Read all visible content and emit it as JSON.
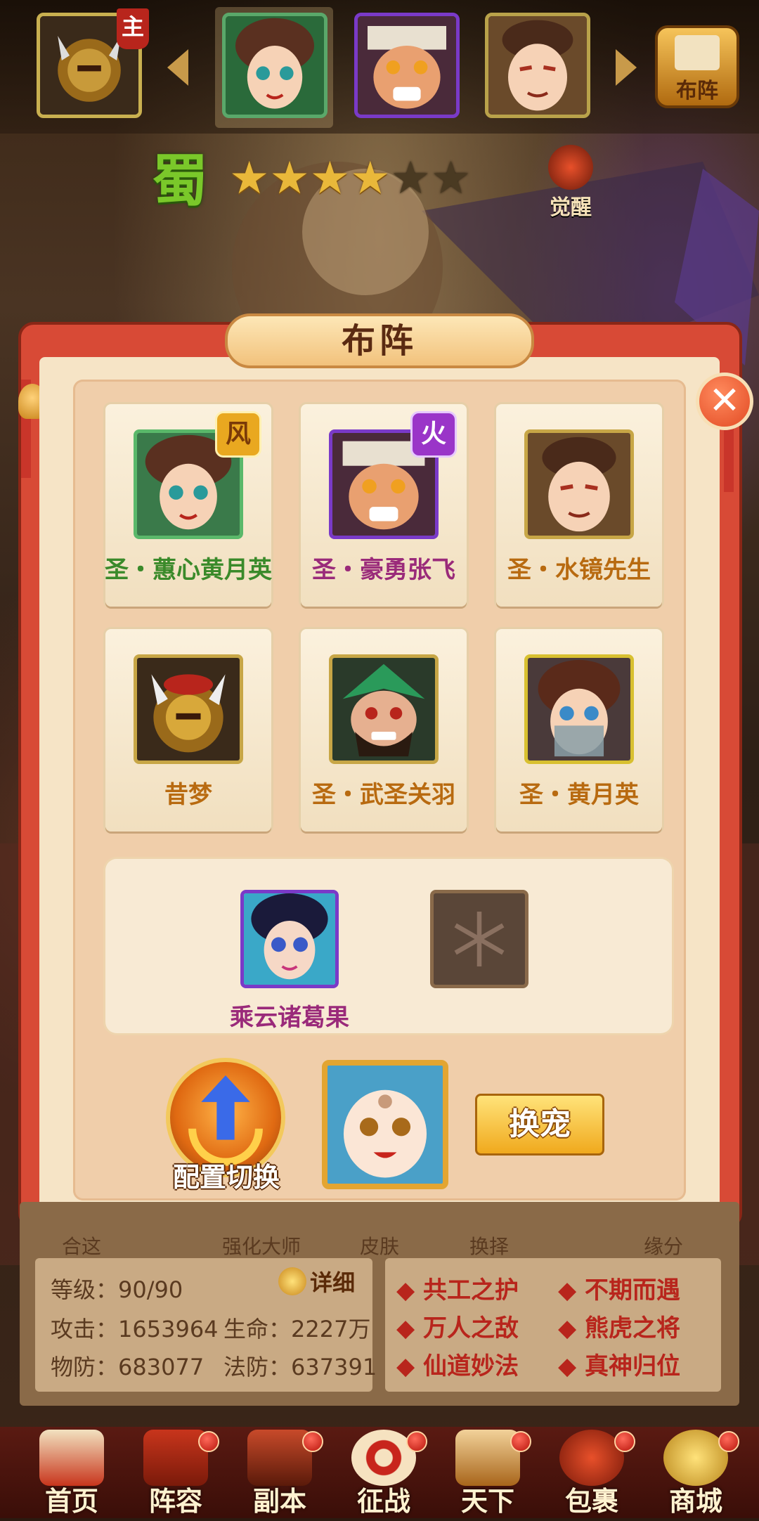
{
  "top_bar": {
    "lord_badge": "主",
    "formation_label": "布阵",
    "heroes": [
      "lord-hero",
      "huang-yueying",
      "zhang-fei",
      "shui-jing"
    ]
  },
  "hero_info": {
    "faction": "蜀",
    "stars": 6,
    "stars_lit": 4,
    "awaken_label": "觉醒"
  },
  "dialog": {
    "title": "布阵",
    "cards": [
      {
        "name": "圣・蕙心黄月英",
        "color": "#3a8a2a",
        "badge": "风",
        "badge_color": "#e9a820"
      },
      {
        "name": "圣・豪勇张飞",
        "color": "#9a2a7a",
        "badge": "火",
        "badge_color": "#9a35c8"
      },
      {
        "name": "圣・水镜先生",
        "color": "#b86a10",
        "badge": "",
        "badge_color": ""
      },
      {
        "name": "昔梦",
        "color": "#b86a10",
        "badge": "",
        "badge_color": ""
      },
      {
        "name": "圣・武圣关羽",
        "color": "#b86a10",
        "badge": "",
        "badge_color": ""
      },
      {
        "name": "圣・黄月英",
        "color": "#b86a10",
        "badge": "",
        "badge_color": ""
      }
    ],
    "support_name": "乘云诸葛果",
    "support_color": "#9a2a7a",
    "config_switch_label": "配置切换",
    "swap_pet_label": "换宠"
  },
  "tabs_partial": [
    "合这",
    "强化大师",
    "皮肤",
    "换择",
    "缘分"
  ],
  "stats": {
    "level_label": "等级：",
    "level_value": "90/90",
    "detail_label": "详细",
    "attack_label": "攻击：",
    "attack_value": "1653964",
    "hp_label": "生命：",
    "hp_value": "2227万",
    "pdef_label": "物防：",
    "pdef_value": "683077",
    "mdef_label": "法防：",
    "mdef_value": "637391"
  },
  "skills": [
    "共工之护",
    "不期而遇",
    "万人之敌",
    "熊虎之将",
    "仙道妙法",
    "真神归位"
  ],
  "nav": [
    {
      "label": "首页",
      "icon": "home-icon"
    },
    {
      "label": "阵容",
      "icon": "lineup-icon"
    },
    {
      "label": "副本",
      "icon": "dungeon-icon"
    },
    {
      "label": "征战",
      "icon": "battle-icon"
    },
    {
      "label": "天下",
      "icon": "world-icon"
    },
    {
      "label": "包裹",
      "icon": "bag-icon"
    },
    {
      "label": "商城",
      "icon": "shop-icon"
    }
  ]
}
